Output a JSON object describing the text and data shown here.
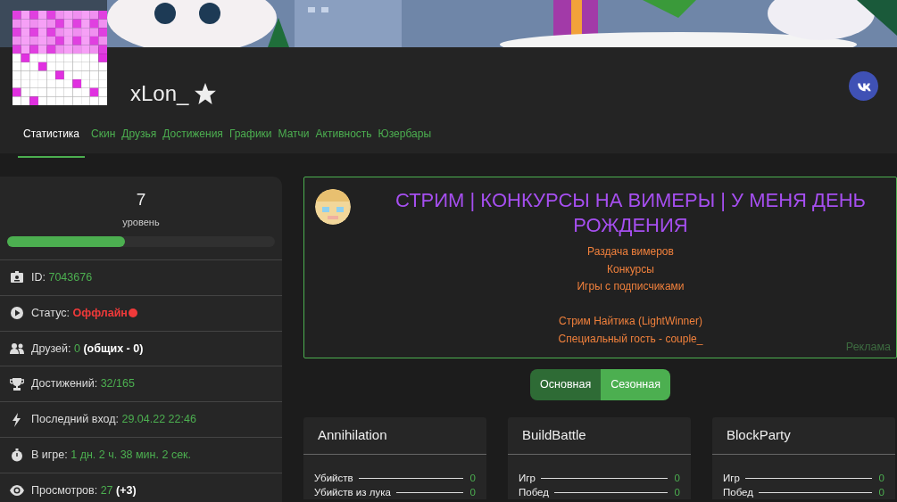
{
  "profile": {
    "name": "xLon_",
    "starred": true
  },
  "tabs": [
    {
      "label": "Статистика",
      "selected": true
    },
    {
      "label": "Скин",
      "selected": false
    },
    {
      "label": "Друзья",
      "selected": false
    },
    {
      "label": "Достижения",
      "selected": false
    },
    {
      "label": "Графики",
      "selected": false
    },
    {
      "label": "Матчи",
      "selected": false
    },
    {
      "label": "Активность",
      "selected": false
    },
    {
      "label": "Юзербары",
      "selected": false
    }
  ],
  "level": {
    "value": "7",
    "caption": "уровень",
    "level": 0.44
  },
  "stats": [
    {
      "kind": "id",
      "label": "ID:",
      "value": "7043676"
    },
    {
      "kind": "status",
      "label": "Статус:",
      "value": "Оффлайн",
      "online": false
    },
    {
      "kind": "friends",
      "label": "Друзей:",
      "value": "0",
      "note": "(общих - 0)"
    },
    {
      "kind": "achievements",
      "label": "Достижений:",
      "value": "32/165"
    },
    {
      "kind": "last_login",
      "label": "Последний вход:",
      "value": "29.04.22 22:46"
    },
    {
      "kind": "playtime",
      "label": "В игре:",
      "value": "1 дн. 2 ч. 38 мин. 2 сек."
    },
    {
      "kind": "views",
      "label": "Просмотров:",
      "value": "27",
      "note": "(+3)"
    }
  ],
  "ad": {
    "title": "СТРИМ | КОНКУРСЫ НА ВИМЕРЫ | У МЕНЯ ДЕНЬ РОЖДЕНИЯ",
    "line_groups": [
      [
        "Раздача вимеров",
        "Конкурсы",
        "Игры с подписчиками"
      ],
      [
        "Стрим Найтика (LightWinner)",
        "Специальный гость - couple_"
      ]
    ],
    "tag": "Реклама"
  },
  "modes": [
    {
      "label": "Основная",
      "selected": true
    },
    {
      "label": "Сезонная",
      "selected": false
    }
  ],
  "games": [
    {
      "title": "Annihilation",
      "rows": [
        {
          "label": "Убийств",
          "value": "0"
        },
        {
          "label": "Убийств из лука",
          "value": "0"
        }
      ]
    },
    {
      "title": "BuildBattle",
      "rows": [
        {
          "label": "Игр",
          "value": "0"
        },
        {
          "label": "Побед",
          "value": "0"
        }
      ]
    },
    {
      "title": "BlockParty",
      "rows": [
        {
          "label": "Игр",
          "value": "0"
        },
        {
          "label": "Побед",
          "value": "0"
        }
      ]
    }
  ]
}
